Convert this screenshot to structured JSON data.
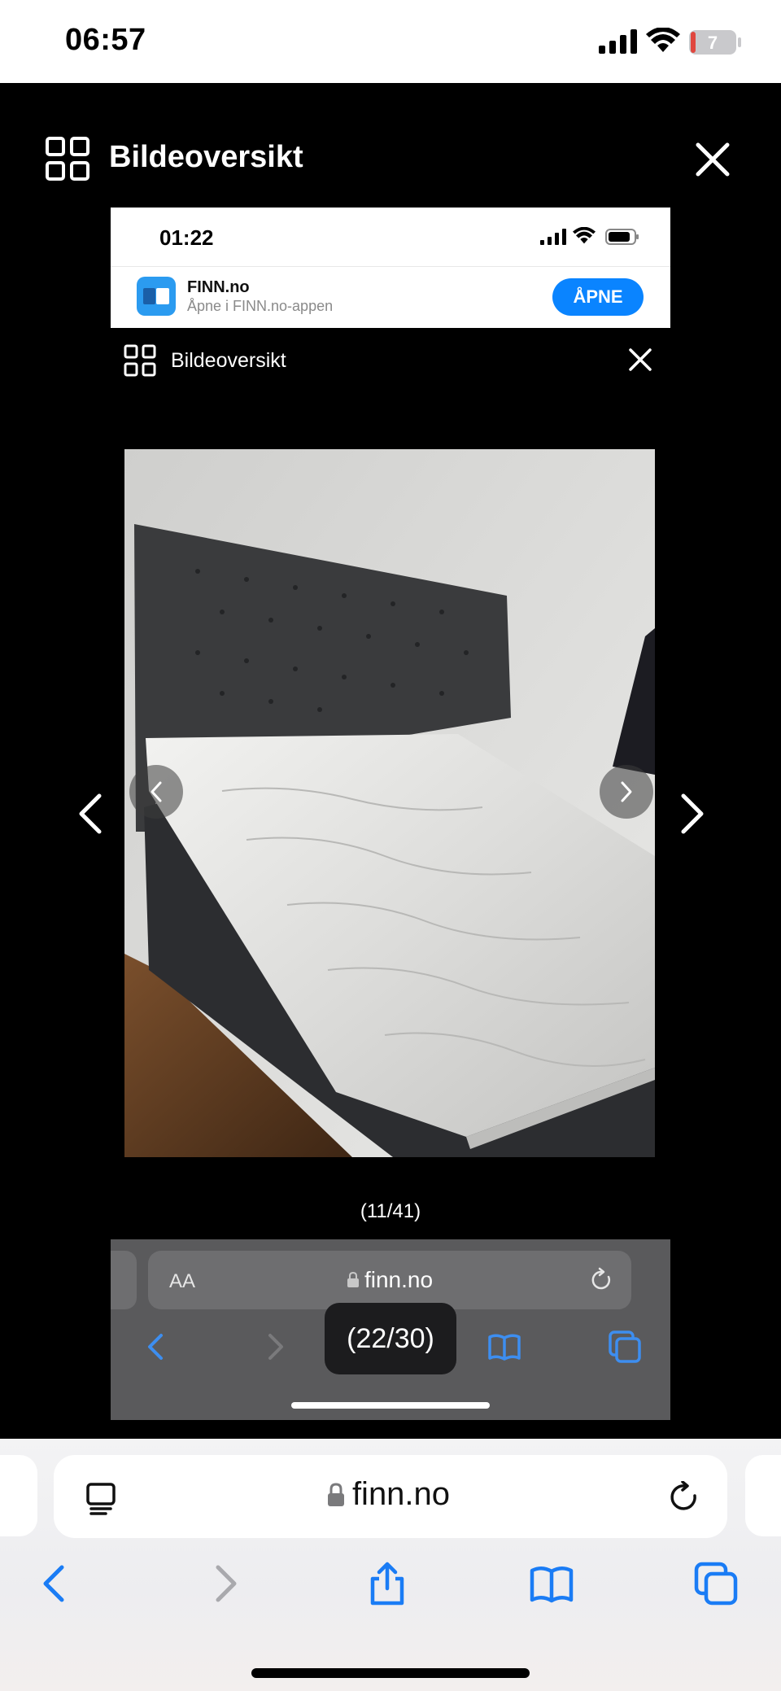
{
  "status_bar": {
    "time": "06:57",
    "battery_level": "7",
    "icons": [
      "cellular-signal-icon",
      "wifi-icon",
      "battery-icon"
    ]
  },
  "viewer": {
    "title": "Bildeoversikt",
    "icons": [
      "grid-icon",
      "close-icon",
      "chevron-left-icon",
      "chevron-right-icon"
    ]
  },
  "nested_screenshot": {
    "status_time": "01:22",
    "app_banner": {
      "name": "FINN.no",
      "subtitle": "Åpne i FINN.no-appen",
      "open_label": "ÅPNE"
    },
    "viewer_title": "Bildeoversikt",
    "image_counter": "(11/41)",
    "toolbar": {
      "aa_label": "AA",
      "url": "finn.no"
    },
    "screenshot_counter": "(22/30)"
  },
  "safari": {
    "url": "finn.no",
    "icons": [
      "tab-overview-icon",
      "lock-icon",
      "reload-icon",
      "back-icon",
      "forward-icon",
      "share-icon",
      "bookmarks-icon",
      "tabs-icon"
    ]
  },
  "colors": {
    "accent": "#0a84ff",
    "background": "#000000",
    "safari_bar": "#f2f2f4",
    "battery_low": "#e0473f"
  }
}
